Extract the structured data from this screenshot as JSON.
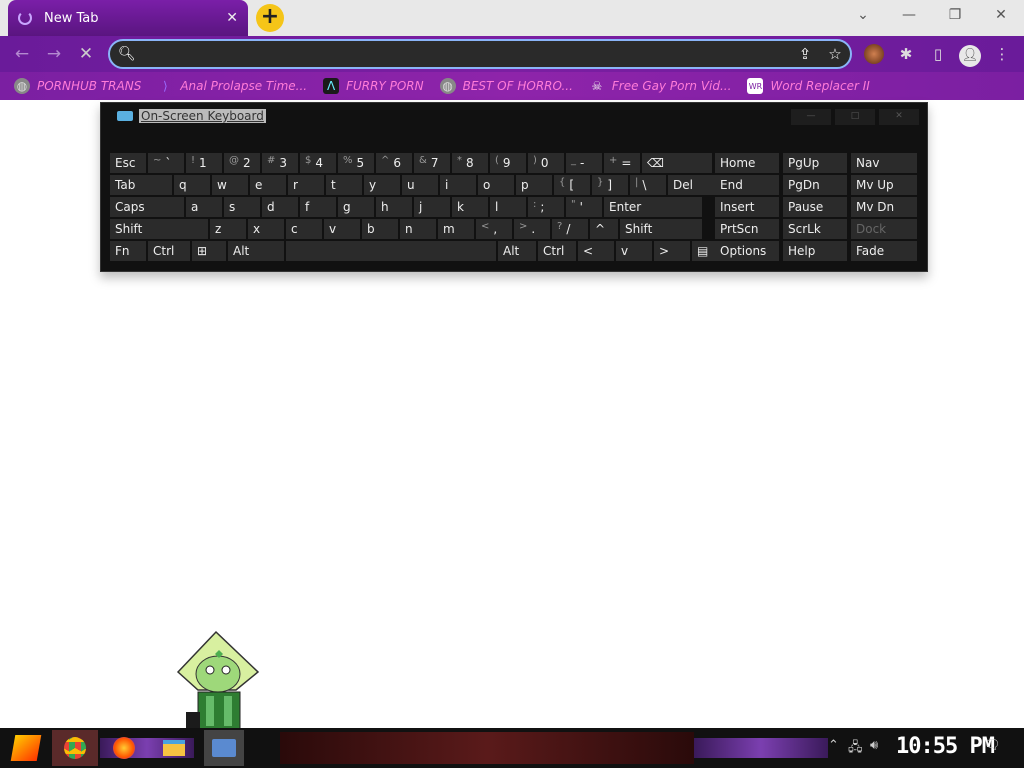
{
  "browser": {
    "tab_title": "New Tab",
    "tab_close": "✕",
    "new_tab": "+",
    "omnibox_value": "",
    "omnibox_placeholder": "",
    "bookmarks": [
      {
        "label": "PORNHUB TRANS",
        "icon": "globe-icon"
      },
      {
        "label": "Anal Prolapse Time...",
        "icon": "bracket-icon"
      },
      {
        "label": "FURRY PORN",
        "icon": "lambda-icon"
      },
      {
        "label": "BEST OF HORRO...",
        "icon": "globe-icon"
      },
      {
        "label": "Free Gay Porn Vid...",
        "icon": "skull-icon"
      },
      {
        "label": "Word Replacer II",
        "icon": "wr-icon"
      }
    ]
  },
  "osk": {
    "title": "On-Screen Keyboard",
    "rows": [
      [
        {
          "k": "Esc"
        },
        {
          "s": "~",
          "k": "`"
        },
        {
          "s": "!",
          "k": "1"
        },
        {
          "s": "@",
          "k": "2"
        },
        {
          "s": "#",
          "k": "3"
        },
        {
          "s": "$",
          "k": "4"
        },
        {
          "s": "%",
          "k": "5"
        },
        {
          "s": "^",
          "k": "6"
        },
        {
          "s": "&",
          "k": "7"
        },
        {
          "s": "*",
          "k": "8"
        },
        {
          "s": "(",
          "k": "9"
        },
        {
          "s": ")",
          "k": "0"
        },
        {
          "s": "_",
          "k": "-"
        },
        {
          "s": "+",
          "k": "="
        },
        {
          "k": "⌫"
        }
      ],
      [
        {
          "k": "Tab"
        },
        {
          "k": "q"
        },
        {
          "k": "w"
        },
        {
          "k": "e"
        },
        {
          "k": "r"
        },
        {
          "k": "t"
        },
        {
          "k": "y"
        },
        {
          "k": "u"
        },
        {
          "k": "i"
        },
        {
          "k": "o"
        },
        {
          "k": "p"
        },
        {
          "s": "{",
          "k": "["
        },
        {
          "s": "}",
          "k": "]"
        },
        {
          "s": "|",
          "k": "\\"
        },
        {
          "k": "Del"
        }
      ],
      [
        {
          "k": "Caps"
        },
        {
          "k": "a"
        },
        {
          "k": "s"
        },
        {
          "k": "d"
        },
        {
          "k": "f"
        },
        {
          "k": "g"
        },
        {
          "k": "h"
        },
        {
          "k": "j"
        },
        {
          "k": "k"
        },
        {
          "k": "l"
        },
        {
          "s": ":",
          "k": ";"
        },
        {
          "s": "\"",
          "k": "'"
        },
        {
          "k": "Enter"
        }
      ],
      [
        {
          "k": "Shift"
        },
        {
          "k": "z"
        },
        {
          "k": "x"
        },
        {
          "k": "c"
        },
        {
          "k": "v"
        },
        {
          "k": "b"
        },
        {
          "k": "n"
        },
        {
          "k": "m"
        },
        {
          "s": "<",
          "k": ","
        },
        {
          "s": ">",
          "k": "."
        },
        {
          "s": "?",
          "k": "/"
        },
        {
          "k": "^"
        },
        {
          "k": "Shift"
        }
      ],
      [
        {
          "k": "Fn"
        },
        {
          "k": "Ctrl"
        },
        {
          "k": "⊞"
        },
        {
          "k": "Alt"
        },
        {
          "k": ""
        },
        {
          "k": "Alt"
        },
        {
          "k": "Ctrl"
        },
        {
          "k": "<"
        },
        {
          "k": "v"
        },
        {
          "k": ">"
        },
        {
          "k": "▤"
        }
      ]
    ],
    "nav": [
      [
        "Home",
        "PgUp",
        "Nav"
      ],
      [
        "End",
        "PgDn",
        "Mv Up"
      ],
      [
        "Insert",
        "Pause",
        "Mv Dn"
      ],
      [
        "PrtScn",
        "ScrLk",
        "Dock"
      ],
      [
        "Options",
        "Help",
        "Fade"
      ]
    ]
  },
  "taskbar": {
    "clock": "10:55 PM"
  }
}
